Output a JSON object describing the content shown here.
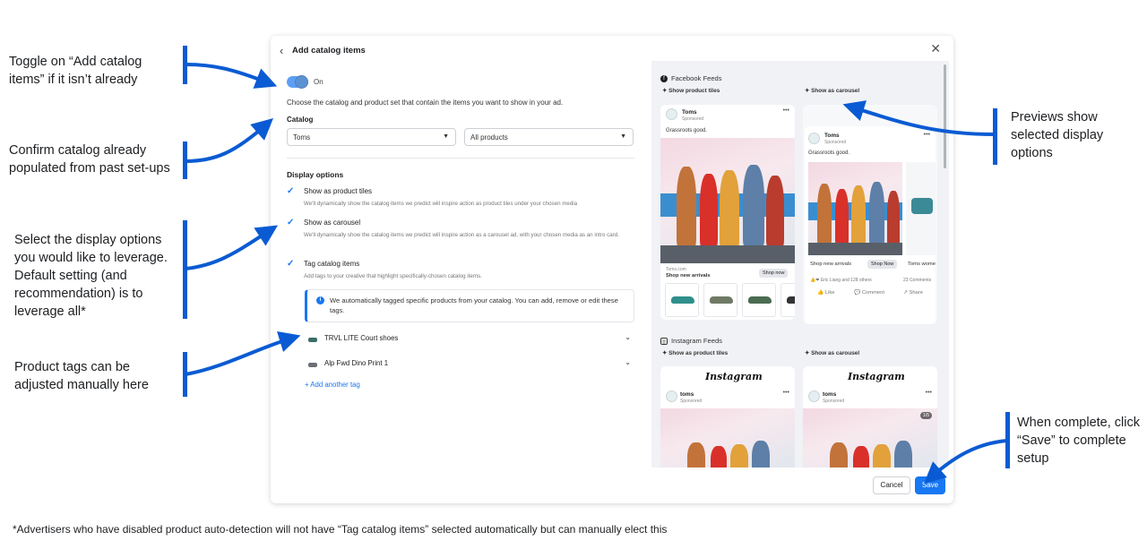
{
  "annotations": {
    "toggle": "Toggle on “Add catalog items” if it isn’t already",
    "catalog": "Confirm catalog already populated from past set-ups",
    "display": "Select the display options you would like to leverage. Default setting (and recommendation) is to leverage all*",
    "tags": "Product tags can be adjusted manually here",
    "previews": "Previews show selected display options",
    "save": "When complete, click “Save” to complete setup"
  },
  "footnote": "*Advertisers who have disabled product auto-detection will not have “Tag catalog items” selected automatically but can manually elect this",
  "modal": {
    "title": "Add catalog items",
    "toggle_label": "On",
    "description": "Choose the catalog and product set that contain the items you want to show in your ad.",
    "catalog_label": "Catalog",
    "catalog_value": "Toms",
    "product_set_value": "All products",
    "display_options_label": "Display options",
    "options": [
      {
        "title": "Show as product tiles",
        "sub": "We'll dynamically show the catalog items we predict will inspire action as product tiles under your chosen media"
      },
      {
        "title": "Show as carousel",
        "sub": "We'll dynamically show the catalog items we predict will inspire action as a carousel ad, with your chosen media as an intro card."
      },
      {
        "title": "Tag catalog items",
        "sub": "Add tags to your creative that highlight specifically-chosen catalog items."
      }
    ],
    "info_text": "We automatically tagged specific products from your catalog. You can add, remove or edit these tags.",
    "tags": [
      "TRVL LITE Court shoes",
      "Alp Fwd Dino Print 1"
    ],
    "add_tag": "+ Add another tag",
    "cancel": "Cancel",
    "save": "Save"
  },
  "preview": {
    "fb_heading": "Facebook Feeds",
    "ig_heading": "Instagram Feeds",
    "product_tiles": "Show product tiles",
    "carousel": "Show as carousel",
    "show_product_tiles": "Show as product tiles",
    "brand_fb": "Toms",
    "brand_ig": "toms",
    "sponsored": "Sponsored",
    "caption": "Grassroots good.",
    "link": "Toms.com",
    "shop_new": "Shop new arrivals",
    "shop_now_btn": "Shop now",
    "shop_now_btn2": "Shop Now",
    "toms_wome": "Toms wome",
    "reactions": "Eric Liang and 128 others",
    "comments": "23 Comments",
    "like": "Like",
    "comment": "Comment",
    "share": "Share",
    "instagram": "Instagram",
    "counter": "1/5"
  },
  "colors": {
    "accent": "#1877f2",
    "annotation_blue": "#0a5bd3"
  }
}
